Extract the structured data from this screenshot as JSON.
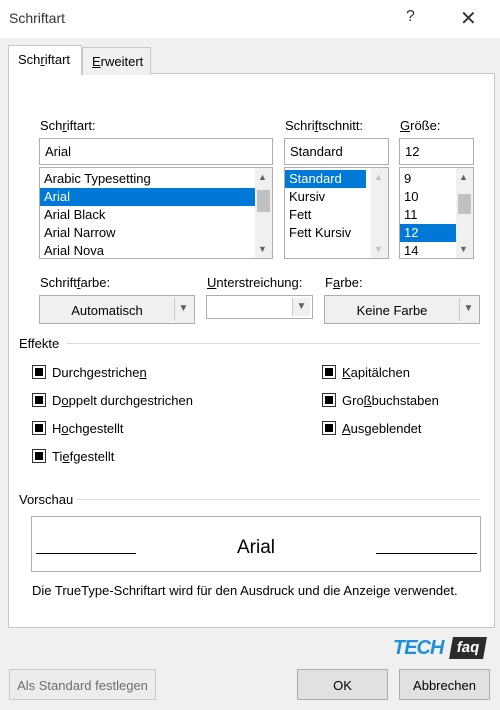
{
  "window": {
    "title": "Schriftart",
    "help_glyph": "?",
    "close_glyph": "✕"
  },
  "tabs": [
    {
      "label": "Schriftart",
      "accel": "r",
      "selected": true
    },
    {
      "label": "Erweitert",
      "accel": "E",
      "selected": false
    }
  ],
  "font": {
    "label": "Schriftart:",
    "value": "Arial",
    "items": [
      "Arabic Typesetting",
      "Arial",
      "Arial Black",
      "Arial Narrow",
      "Arial Nova"
    ],
    "selected_index": 1
  },
  "style": {
    "label": "Schriftschnitt:",
    "value": "Standard",
    "items": [
      "Standard",
      "Kursiv",
      "Fett",
      "Fett Kursiv"
    ],
    "selected_index": 0
  },
  "size": {
    "label": "Größe:",
    "value": "12",
    "items": [
      "9",
      "10",
      "11",
      "12",
      "14"
    ],
    "selected_index": 3
  },
  "font_color": {
    "label": "Schriftfarbe:",
    "value": "Automatisch"
  },
  "underline": {
    "label": "Unterstreichung:",
    "value": ""
  },
  "underline_color": {
    "label": "Farbe:",
    "value": "Keine Farbe"
  },
  "effects": {
    "label": "Effekte",
    "items": [
      {
        "label": "Durchgestrichen"
      },
      {
        "label": "Doppelt durchgestrichen"
      },
      {
        "label": "Hochgestellt"
      },
      {
        "label": "Tiefgestellt"
      },
      {
        "label": "Kapitälchen"
      },
      {
        "label": "Großbuchstaben"
      },
      {
        "label": "Ausgeblendet"
      }
    ]
  },
  "preview": {
    "label": "Vorschau",
    "sample": "Arial",
    "description": "Die TrueType-Schriftart wird für den Ausdruck und die Anzeige verwendet."
  },
  "buttons": {
    "set_default": "Als Standard festlegen",
    "ok": "OK",
    "cancel": "Abbrechen"
  },
  "watermark": {
    "text_left": "TECH",
    "text_right": "faq"
  },
  "colors": {
    "selection": "#0078d7",
    "watermark_blue": "#1e8fd8",
    "watermark_faq_bg": "#2b2b2b"
  }
}
